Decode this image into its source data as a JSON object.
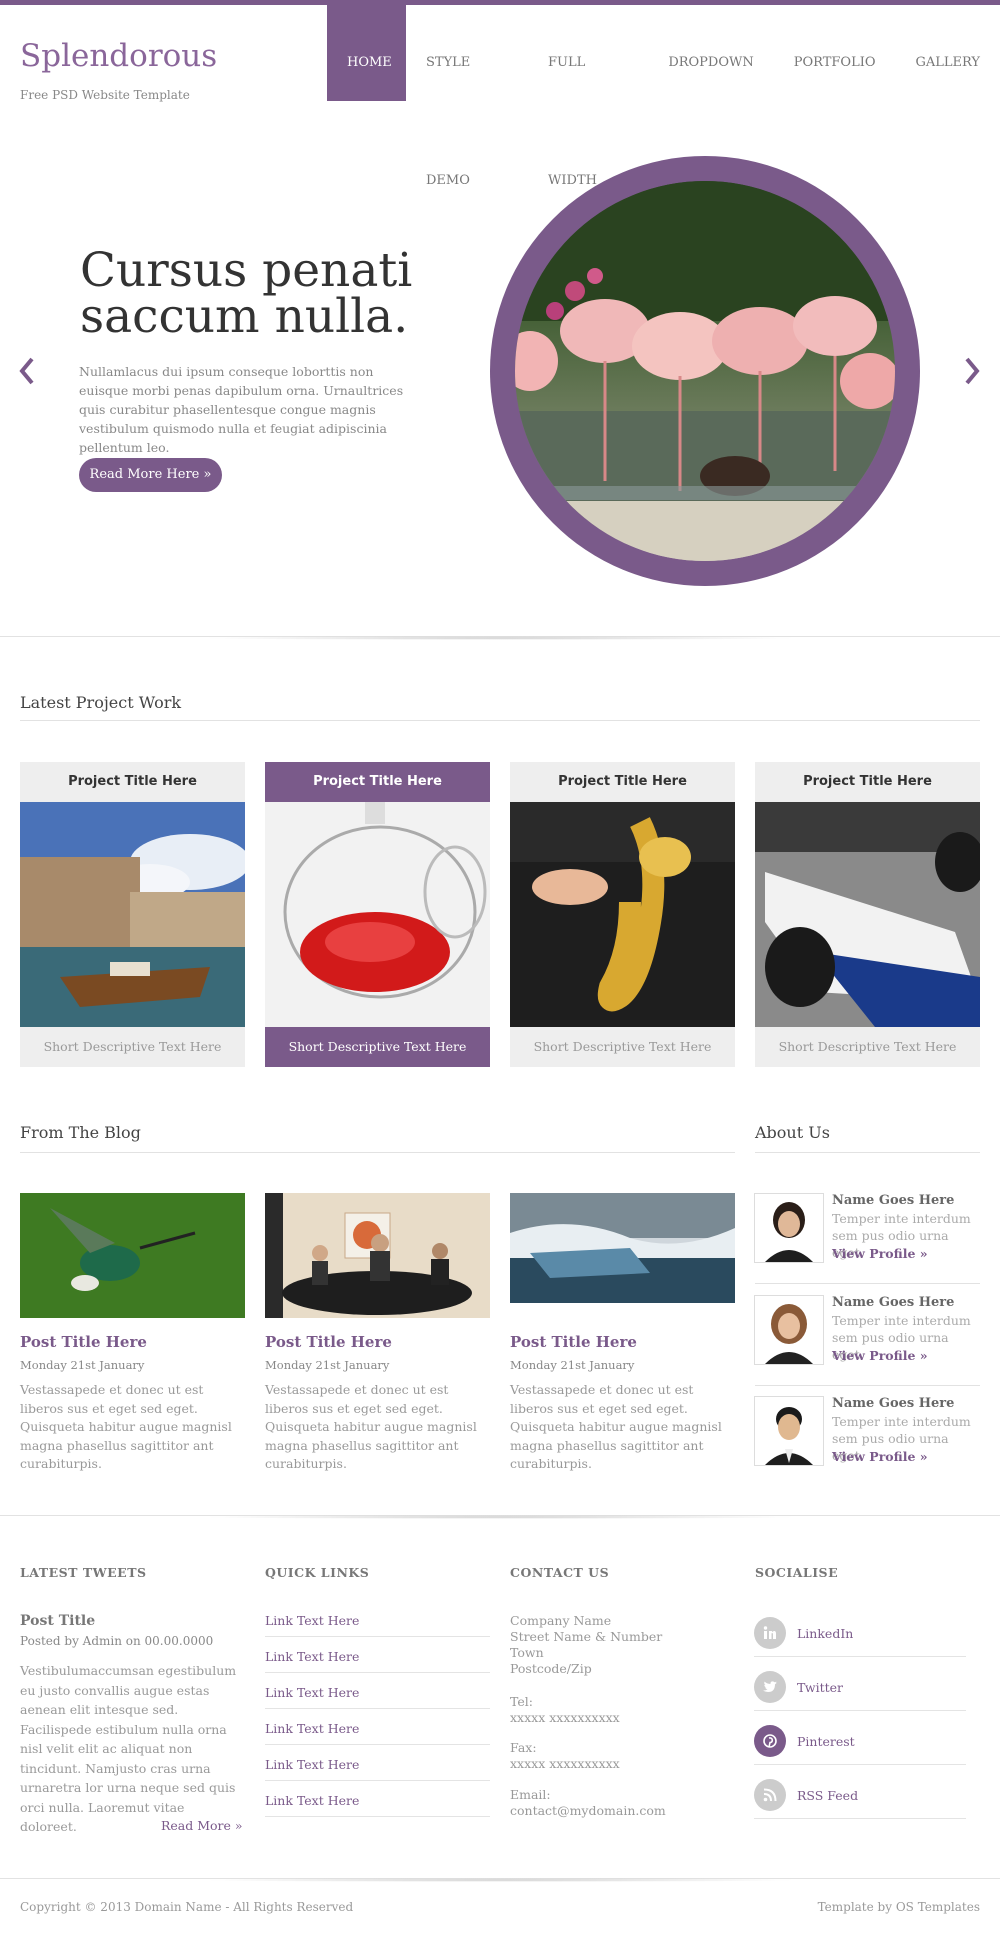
{
  "site": {
    "name": "Splendorous",
    "tagline": "Free PSD Website Template"
  },
  "nav": [
    {
      "label": "HOME",
      "active": true
    },
    {
      "label": "STYLE DEMO",
      "active": false
    },
    {
      "label": "FULL WIDTH",
      "active": false
    },
    {
      "label": "DROPDOWN",
      "active": false
    },
    {
      "label": "PORTFOLIO",
      "active": false
    },
    {
      "label": "GALLERY",
      "active": false
    }
  ],
  "hero": {
    "title_line1": "Cursus penati",
    "title_line2": "saccum nulla.",
    "text": "Nullamlacus dui ipsum conseque loborttis non euisque morbi penas dapibulum orna. Urnaultrices quis curabitur phasellentesque congue magnis vestibulum quismodo nulla et feugiat adipiscinia pellentum leo.",
    "button": "Read More Here »"
  },
  "projects": {
    "heading": "Latest Project Work",
    "items": [
      {
        "title": "Project Title Here",
        "caption": "Short Descriptive Text Here"
      },
      {
        "title": "Project Title Here",
        "caption": "Short Descriptive Text Here"
      },
      {
        "title": "Project Title Here",
        "caption": "Short Descriptive Text Here"
      },
      {
        "title": "Project Title Here",
        "caption": "Short Descriptive Text Here"
      }
    ]
  },
  "blog": {
    "heading": "From The Blog",
    "posts": [
      {
        "title": "Post Title Here",
        "date": "Monday 21st January",
        "text": "Vestassapede et donec ut est liberos sus et eget sed eget. Quisqueta habitur augue magnisl magna phasellus sagittitor ant curabiturpis."
      },
      {
        "title": "Post Title Here",
        "date": "Monday 21st January",
        "text": "Vestassapede et donec ut est liberos sus et eget sed eget. Quisqueta habitur augue magnisl magna phasellus sagittitor ant curabiturpis."
      },
      {
        "title": "Post Title Here",
        "date": "Monday 21st January",
        "text": "Vestassapede et donec ut est liberos sus et eget sed eget. Quisqueta habitur augue magnisl magna phasellus sagittitor ant curabiturpis."
      }
    ]
  },
  "about": {
    "heading": "About Us",
    "people": [
      {
        "name": "Name Goes Here",
        "text": "Temper inte interdum sem pus odio urna eget.",
        "link": "View Profile »"
      },
      {
        "name": "Name Goes Here",
        "text": "Temper inte interdum sem pus odio urna eget.",
        "link": "View Profile »"
      },
      {
        "name": "Name Goes Here",
        "text": "Temper inte interdum sem pus odio urna eget.",
        "link": "View Profile »"
      }
    ]
  },
  "footer": {
    "tweets": {
      "heading": "LATEST TWEETS",
      "title": "Post Title",
      "meta": "Posted by Admin on 00.00.0000",
      "text": "Vestibulumaccumsan egestibulum eu justo convallis augue estas aenean elit intesque sed. Facilispede estibulum nulla orna nisl velit elit ac aliquat non tincidunt. Namjusto cras urna urnaretra lor urna neque sed quis orci nulla. Laoremut vitae doloreet.",
      "more": "Read More »"
    },
    "quick_links": {
      "heading": "QUICK LINKS",
      "links": [
        "Link Text Here",
        "Link Text Here",
        "Link Text Here",
        "Link Text Here",
        "Link Text Here",
        "Link Text Here"
      ]
    },
    "contact": {
      "heading": "CONTACT US",
      "address": [
        "Company Name",
        "Street Name & Number",
        "Town",
        "Postcode/Zip"
      ],
      "tel_label": "Tel:",
      "tel": "xxxxx xxxxxxxxxx",
      "fax_label": "Fax:",
      "fax": "xxxxx xxxxxxxxxx",
      "email_label": "Email:",
      "email": "contact@mydomain.com"
    },
    "social": {
      "heading": "SOCIALISE",
      "items": [
        {
          "label": "LinkedIn",
          "icon": "linkedin-icon"
        },
        {
          "label": "Twitter",
          "icon": "twitter-icon"
        },
        {
          "label": "Pinterest",
          "icon": "pinterest-icon"
        },
        {
          "label": "RSS Feed",
          "icon": "rss-icon"
        }
      ]
    },
    "copyright": "Copyright © 2013 Domain Name - All Rights Reserved",
    "credit": "Template by OS Templates"
  },
  "colors": {
    "accent": "#7a5a8a",
    "text": "#555555",
    "muted": "#999999"
  }
}
